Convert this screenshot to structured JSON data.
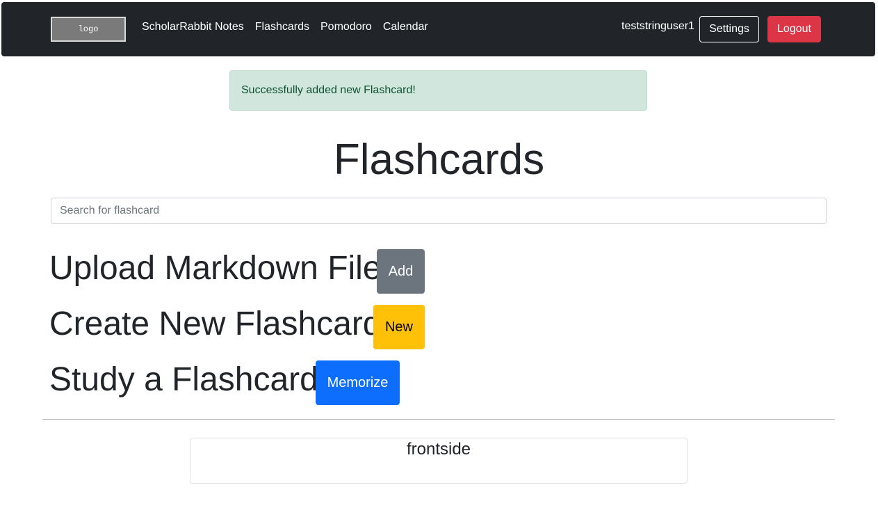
{
  "navbar": {
    "logo_text": "logo",
    "links": [
      "ScholarRabbit Notes",
      "Flashcards",
      "Pomodoro",
      "Calendar"
    ],
    "username": "teststringuser1",
    "settings_label": "Settings",
    "logout_label": "Logout"
  },
  "alert": {
    "message": "Successfully added new Flashcard!"
  },
  "main": {
    "title": "Flashcards",
    "search_placeholder": "Search for flashcard",
    "actions": [
      {
        "heading": "Upload Markdown File",
        "button": "Add"
      },
      {
        "heading": "Create New Flashcard",
        "button": "New"
      },
      {
        "heading": "Study a Flashcard",
        "button": "Memorize"
      }
    ]
  },
  "flashcards": [
    {
      "front": "frontside"
    }
  ],
  "colors": {
    "navbar_bg": "#212529",
    "alert_success_bg": "#d1e7dd",
    "alert_success_text": "#0f5132",
    "logout_red": "#dc3545",
    "add_gray": "#6c757d",
    "new_yellow": "#ffc107",
    "memorize_blue": "#0d6efd"
  }
}
